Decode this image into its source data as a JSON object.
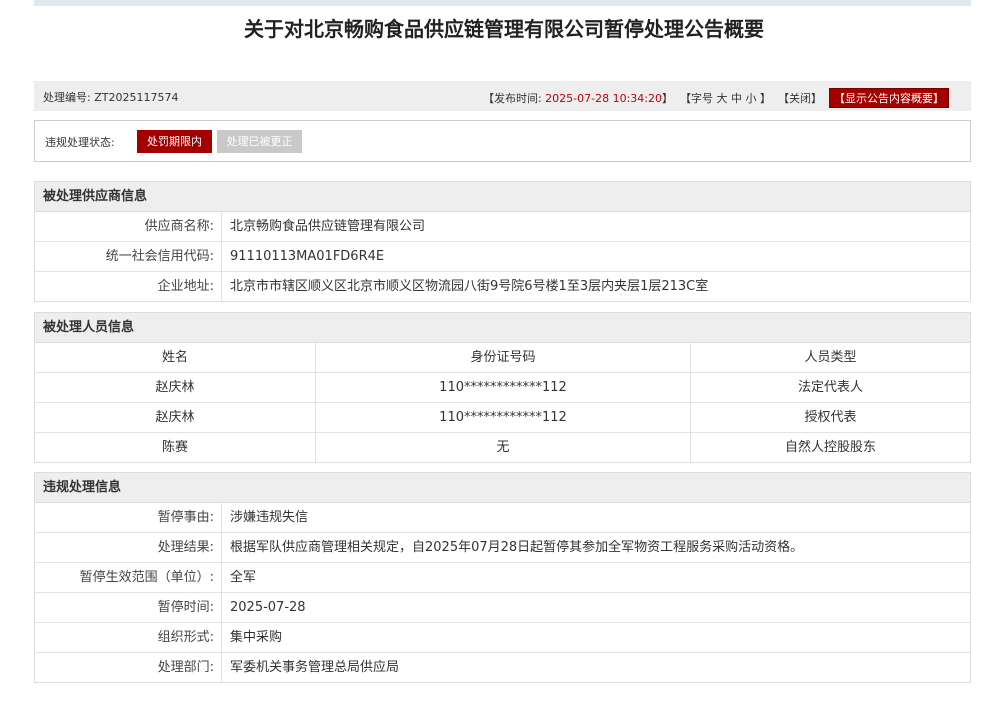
{
  "title": "关于对北京畅购食品供应链管理有限公司暂停处理公告概要",
  "meta": {
    "code_label": "处理编号:",
    "code_value": "ZT2025117574",
    "publish_open": "【发布时间: ",
    "publish_time": "2025-07-28 10:34:20",
    "publish_close": "】",
    "font_open": "【字号",
    "font_large": "大",
    "font_medium": "中",
    "font_small": "小",
    "font_close": "】",
    "close_label": "【关闭】",
    "summary_label": "【显示公告内容概要】"
  },
  "status": {
    "label": "违规处理状态:",
    "stage1": "处罚期限内",
    "stage2": "处理已被更正"
  },
  "supplier": {
    "heading": "被处理供应商信息",
    "rows": [
      {
        "key": "供应商名称:",
        "value": "北京畅购食品供应链管理有限公司"
      },
      {
        "key": "统一社会信用代码:",
        "value": "91110113MA01FD6R4E"
      },
      {
        "key": "企业地址:",
        "value": "北京市市辖区顺义区北京市顺义区物流园八街9号院6号楼1至3层内夹层1层213C室"
      }
    ]
  },
  "persons": {
    "heading": "被处理人员信息",
    "columns": [
      "姓名",
      "身份证号码",
      "人员类型"
    ],
    "rows": [
      [
        "赵庆林",
        "110************112",
        "法定代表人"
      ],
      [
        "赵庆林",
        "110************112",
        "授权代表"
      ],
      [
        "陈赛",
        "无",
        "自然人控股股东"
      ]
    ]
  },
  "violation": {
    "heading": "违规处理信息",
    "rows": [
      {
        "key": "暂停事由:",
        "value": "涉嫌违规失信"
      },
      {
        "key": "处理结果:",
        "value": "根据军队供应商管理相关规定，自2025年07月28日起暂停其参加全军物资工程服务采购活动资格。"
      },
      {
        "key": "暂停生效范围（单位）:",
        "value": "全军"
      },
      {
        "key": "暂停时间:",
        "value": "2025-07-28"
      },
      {
        "key": "组织形式:",
        "value": "集中采购"
      },
      {
        "key": "处理部门:",
        "value": "军委机关事务管理总局供应局"
      }
    ]
  }
}
